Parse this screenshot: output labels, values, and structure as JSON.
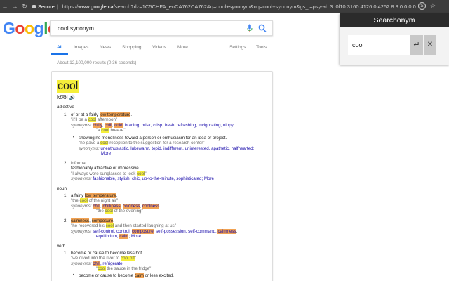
{
  "browser": {
    "secure_label": "Secure",
    "url_prefix": "https://",
    "url_host": "www.google.ca",
    "url_rest": "/search?rlz=1C5CHFA_enCA762CA762&q=cool+synonym&oq=cool+synonym&gs_l=psy-ab.3..0l10.3160.4126.0.4262.8.8.0.0.0.0..."
  },
  "google": {
    "logo": [
      "G",
      "o",
      "o",
      "g",
      "l",
      "e"
    ],
    "query": "cool synonym",
    "tabs": [
      "All",
      "Images",
      "News",
      "Shopping",
      "Videos",
      "More",
      "Settings",
      "Tools"
    ],
    "results_count": "About 12,100,000 results (0.36 seconds)"
  },
  "dictionary": {
    "word": "cool",
    "phonetic": "ko͞ol",
    "speaker": "🔊",
    "pos": [
      "adjective",
      "noun",
      "verb"
    ],
    "adj": {
      "s1": {
        "num": "1.",
        "def_a": "of or at a fairly ",
        "def_hl": "low temperature",
        "def_b": ".",
        "ex_a": "\"it'll be a ",
        "ex_hl": "cool",
        "ex_b": " afternoon\"",
        "syn_label": "synonyms:",
        "syn_1": "chilly",
        "syn_2": "chill",
        "syn_3": "cold",
        "syn_rest": ", bracing, brisk, crisp, fresh, refreshing, invigorating, nippy",
        "ex2_a": "\"a ",
        "ex2_hl": "cool",
        "ex2_b": " breeze\"",
        "sub_def": "showing no friendliness toward a person or enthusiasm for an idea or project.",
        "sub_ex_a": "\"he gave a ",
        "sub_ex_hl": "cool",
        "sub_ex_b": " reception to the suggestion for a research center\"",
        "sub_syn_label": "synonyms:",
        "sub_syn": "unenthusiastic, lukewarm, tepid, indifferent, uninterested, apathetic, halfhearted;",
        "sub_more": "More"
      },
      "s2": {
        "num": "2.",
        "label": "informal",
        "def": "fashionably attractive or impressive.",
        "ex_a": "\"I always wore sunglasses to look ",
        "ex_hl": "cool",
        "ex_b": "\"",
        "syn_label": "synonyms:",
        "syn": "fashionable, stylish, chic, up-to-the-minute, sophisticated;",
        "more": "More"
      }
    },
    "noun": {
      "s1": {
        "num": "1.",
        "def_a": "a fairly ",
        "def_hl": "low temperature",
        "def_b": ".",
        "ex_a": "\"the ",
        "ex_hl": "cool",
        "ex_b": " of the night air\"",
        "syn_label": "synonyms:",
        "syn_1": "chill",
        "syn_2a": "chilliness",
        "syn_3": "coldness",
        "syn_4": "coolness",
        "ex2_a": "\"the ",
        "ex2_hl": "cool",
        "ex2_b": " of the evening\""
      },
      "s2": {
        "num": "2.",
        "def_1": "calmness",
        "def_2": "composure",
        "def_b": ".",
        "ex_a": "\"he recovered his ",
        "ex_hl": "cool",
        "ex_b": " and then started laughing at us\"",
        "syn_label": "synonyms:",
        "syn_a": "self-control, control, ",
        "syn_hl1": "composure",
        "syn_b": ", self-possession, self-command, ",
        "syn_hl2": "calmness",
        "syn_c": ",",
        "syn_line2": "equilibrium, ",
        "syn_hl3": "calm",
        "syn_d": ";",
        "more": "More"
      }
    },
    "verb": {
      "s1": {
        "num": "1.",
        "def": "become or cause to become less hot.",
        "ex_a": "\"we dived into the river to ",
        "ex_hl": "cool off",
        "ex_b": "\"",
        "syn_label": "synonyms:",
        "syn_hl": "chill",
        "syn_b": ", refrigerate",
        "ex2_a": "\"",
        "ex2_hl": "cool",
        "ex2_b": " the sauce in the fridge\"",
        "sub_def_a": "become or cause to become ",
        "sub_def_hl": "calm",
        "sub_def_b": " or less excited."
      }
    }
  },
  "popup": {
    "title": "Searchonym",
    "input_value": "cool",
    "enter_glyph": "↵",
    "close_glyph": "✕"
  }
}
